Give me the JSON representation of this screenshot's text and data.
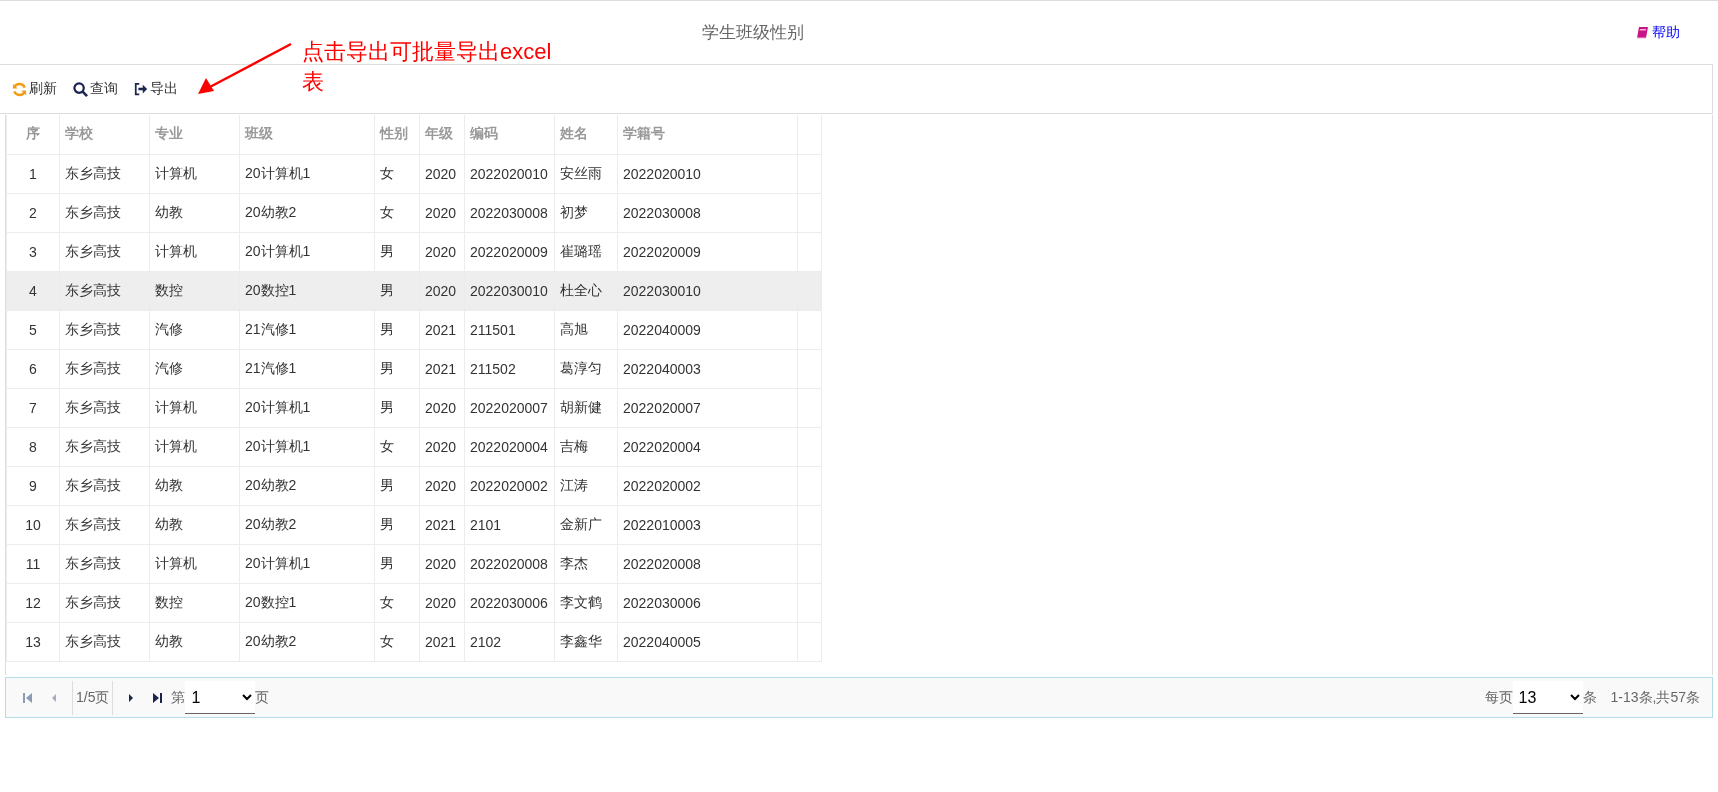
{
  "header": {
    "title": "学生班级性别",
    "help_link": "帮助"
  },
  "toolbar": {
    "buttons": [
      {
        "kind": "refresh",
        "label": "刷新"
      },
      {
        "kind": "search",
        "label": "查询"
      },
      {
        "kind": "export",
        "label": "导出"
      }
    ]
  },
  "annotation": {
    "text": "点击导出可批量导出excel表"
  },
  "table": {
    "columns": [
      "序",
      "学校",
      "专业",
      "班级",
      "性别",
      "年级",
      "编码",
      "姓名",
      "学籍号"
    ],
    "rows": [
      {
        "cells": [
          "1",
          "东乡高技",
          "计算机",
          "20计算机1",
          "女",
          "2020",
          "2022020010",
          "安丝雨",
          "2022020010"
        ],
        "selected": false
      },
      {
        "cells": [
          "2",
          "东乡高技",
          "幼教",
          "20幼教2",
          "女",
          "2020",
          "2022030008",
          "初梦",
          "2022030008"
        ],
        "selected": false
      },
      {
        "cells": [
          "3",
          "东乡高技",
          "计算机",
          "20计算机1",
          "男",
          "2020",
          "2022020009",
          "崔璐瑶",
          "2022020009"
        ],
        "selected": false
      },
      {
        "cells": [
          "4",
          "东乡高技",
          "数控",
          "20数控1",
          "男",
          "2020",
          "2022030010",
          "杜全心",
          "2022030010"
        ],
        "selected": true
      },
      {
        "cells": [
          "5",
          "东乡高技",
          "汽修",
          "21汽修1",
          "男",
          "2021",
          "211501",
          "高旭",
          "2022040009"
        ],
        "selected": false
      },
      {
        "cells": [
          "6",
          "东乡高技",
          "汽修",
          "21汽修1",
          "男",
          "2021",
          "211502",
          "葛淳匀",
          "2022040003"
        ],
        "selected": false
      },
      {
        "cells": [
          "7",
          "东乡高技",
          "计算机",
          "20计算机1",
          "男",
          "2020",
          "2022020007",
          "胡新健",
          "2022020007"
        ],
        "selected": false
      },
      {
        "cells": [
          "8",
          "东乡高技",
          "计算机",
          "20计算机1",
          "女",
          "2020",
          "2022020004",
          "吉梅",
          "2022020004"
        ],
        "selected": false
      },
      {
        "cells": [
          "9",
          "东乡高技",
          "幼教",
          "20幼教2",
          "男",
          "2020",
          "2022020002",
          "江涛",
          "2022020002"
        ],
        "selected": false
      },
      {
        "cells": [
          "10",
          "东乡高技",
          "幼教",
          "20幼教2",
          "男",
          "2021",
          "2101",
          "金新广",
          "2022010003"
        ],
        "selected": false
      },
      {
        "cells": [
          "11",
          "东乡高技",
          "计算机",
          "20计算机1",
          "男",
          "2020",
          "2022020008",
          "李杰",
          "2022020008"
        ],
        "selected": false
      },
      {
        "cells": [
          "12",
          "东乡高技",
          "数控",
          "20数控1",
          "女",
          "2020",
          "2022030006",
          "李文鹤",
          "2022030006"
        ],
        "selected": false
      },
      {
        "cells": [
          "13",
          "东乡高技",
          "幼教",
          "20幼教2",
          "女",
          "2021",
          "2102",
          "李鑫华",
          "2022040005"
        ],
        "selected": false
      }
    ]
  },
  "pager": {
    "page_info": "1/5页",
    "page_prefix": "第",
    "page_value": "1",
    "page_suffix": "页",
    "per_page_prefix": "每页",
    "per_page_value": "13",
    "per_page_suffix": "条",
    "range": "1-13条,共57条"
  }
}
